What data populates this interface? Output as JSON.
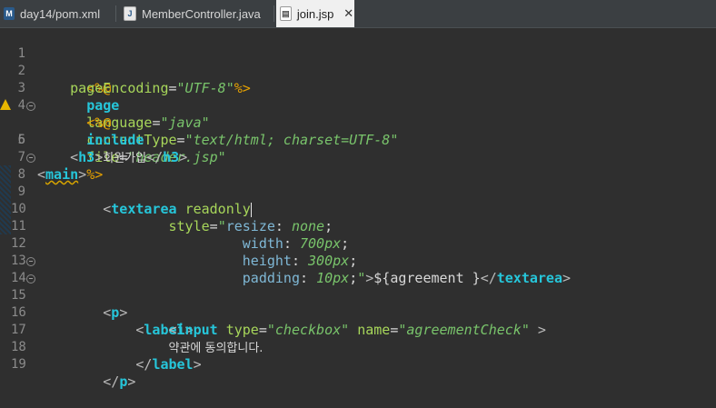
{
  "tabs": [
    {
      "label": "day14/pom.xml",
      "icon": "maven-file-icon",
      "active": false
    },
    {
      "label": "MemberController.java",
      "icon": "java-file-icon",
      "active": false
    },
    {
      "label": "join.jsp",
      "icon": "jsp-file-icon",
      "active": true
    }
  ],
  "close_glyph": "✕",
  "lines": [
    {
      "n": "1"
    },
    {
      "n": "2"
    },
    {
      "n": "3"
    },
    {
      "n": "4"
    },
    {
      "n": "5"
    },
    {
      "n": "6"
    },
    {
      "n": "7"
    },
    {
      "n": "8"
    },
    {
      "n": "9"
    },
    {
      "n": "10"
    },
    {
      "n": "11"
    },
    {
      "n": "12"
    },
    {
      "n": "13"
    },
    {
      "n": "14"
    },
    {
      "n": "15"
    },
    {
      "n": "16"
    },
    {
      "n": "17"
    },
    {
      "n": "18"
    },
    {
      "n": "19"
    }
  ],
  "code": {
    "l1": {
      "open": "<%@",
      "kw": "page",
      "a1": "language",
      "eq1": "=",
      "v1": "\"java\"",
      "a2": "contentType",
      "eq2": "=",
      "v2": "\"text/html; charset=UTF-8\""
    },
    "l2": {
      "a": "pageEncoding",
      "eq": "=",
      "v": "\"UTF-8\"",
      "close": "%>"
    },
    "l3": {
      "open": "<%@",
      "kw": "include",
      "a": "file",
      "eq": "=",
      "v": "\"header.jsp\"",
      "close": "%>"
    },
    "l5": {
      "lt": "<",
      "name": "main",
      "gt": ">"
    },
    "l6": {
      "lt": "<",
      "name": "h3",
      "gt": ">",
      "text": "회원가입",
      "lt2": "</",
      "name2": "h3",
      "gt2": ">"
    },
    "l9": {
      "lt": "<",
      "name": "textarea",
      "attr": "readonly"
    },
    "l10": {
      "a": "style",
      "eq": "=",
      "q": "\"",
      "prop": "resize",
      "colon": ":",
      "val": "none",
      "semi": ";"
    },
    "l11": {
      "prop": "width",
      "colon": ":",
      "val": "700px",
      "semi": ";"
    },
    "l12": {
      "prop": "height",
      "colon": ":",
      "val": "300px",
      "semi": ";"
    },
    "l13": {
      "prop": "padding",
      "colon": ":",
      "val": "10px",
      "semi": ";",
      "q": "\"",
      "gt": ">",
      "expr": "${agreement }",
      "lt2": "</",
      "name2": "textarea",
      "gt2": ">"
    },
    "l14": {
      "lt": "<",
      "name": "p",
      "gt": ">"
    },
    "l15": {
      "lt": "<",
      "name": "label",
      "gt": ">"
    },
    "l16": {
      "lt": "<",
      "name": "input",
      "a1": "type",
      "eq1": "=",
      "v1": "\"checkbox\"",
      "a2": "name",
      "eq2": "=",
      "v2": "\"agreementCheck\"",
      "gt": " >"
    },
    "l17": {
      "text": "약관에 동의합니다."
    },
    "l18": {
      "lt2": "</",
      "name2": "label",
      "gt2": ">"
    },
    "l19": {
      "lt2": "</",
      "name2": "p",
      "gt2": ">"
    }
  }
}
